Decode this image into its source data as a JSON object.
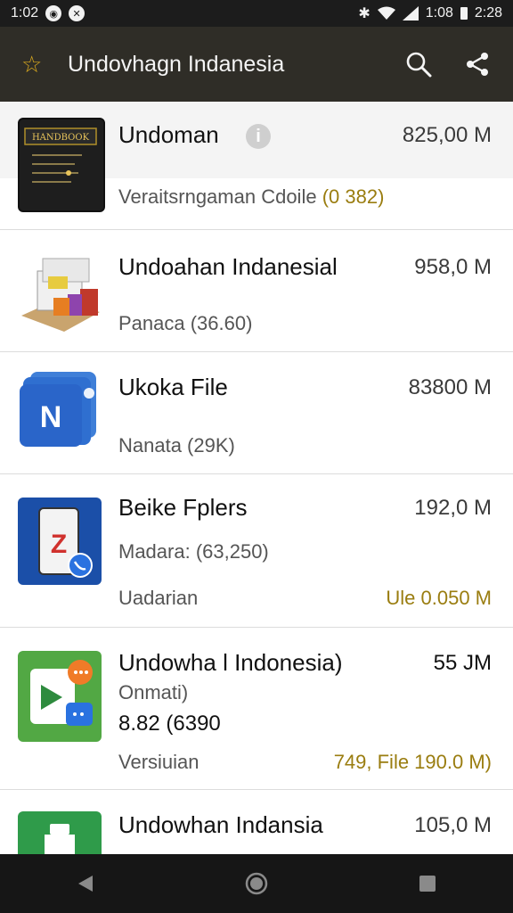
{
  "status_bar": {
    "time": "1:02",
    "right_text_1": "1:08",
    "right_text_2": "2:28"
  },
  "app_bar": {
    "title": "Undovhagn Indanesia",
    "icons": [
      "star-icon",
      "search-icon",
      "share-icon"
    ]
  },
  "items": [
    {
      "name": "Undoman",
      "size": "825,00 M",
      "subtitle_prefix": "Veraitsrngaman Cdoile",
      "subtitle_highlight": "(0 382)",
      "has_info_icon": true
    },
    {
      "name": "Undoahan Indanesial",
      "size": "958,0 M",
      "subtitle": "Panaca (36.60)"
    },
    {
      "name": "Ukoka File",
      "size": "83800 M",
      "subtitle": "Nanata (29K)"
    },
    {
      "name": "Beike Fplers",
      "size": "192,0 M",
      "subtitle": "Madara: (63,250)",
      "footer_left": "Uadarian",
      "footer_right": "Ule  0.050 M"
    },
    {
      "name": "Undowha l Indonesia)",
      "size": "55 JM",
      "line2": "Onmati)",
      "line3": "8.82 (6390",
      "footer_left": "Versiuian",
      "footer_right": "749, File 190.0 M)"
    },
    {
      "name": "Undowhan Indansia",
      "size": "105,0 M"
    }
  ],
  "colors": {
    "app_bar": "#2f2d27",
    "accent_gold": "#9a7d10",
    "star": "#d9a81e",
    "nav_bar": "#161616"
  }
}
